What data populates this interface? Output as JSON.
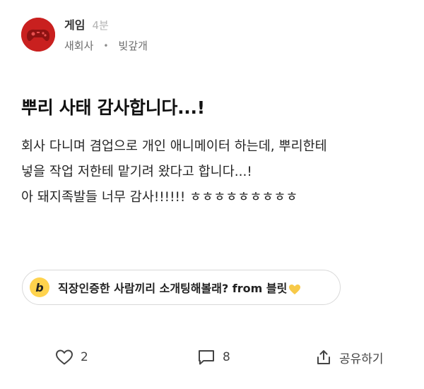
{
  "post": {
    "board_name": "게임",
    "time_ago": "4분",
    "author_company": "새회사",
    "separator": "•",
    "author_nickname": "빚갚개",
    "title": "뿌리 사태 감사합니다...!",
    "body_lines": [
      "회사 다니며 겸업으로 개인 애니메이터 하는데, 뿌리한테",
      "넣을 작업 저한테 맡기려 왔다고 합니다...!",
      "아 돼지족발들 너무 감사!!!!!! ㅎㅎㅎㅎㅎㅎㅎㅎㅎ"
    ]
  },
  "promo": {
    "badge": "b",
    "text": "직장인증한 사람끼리 소개팅해볼래? from 블릿"
  },
  "actions": {
    "like_count": "2",
    "comment_count": "8",
    "share_label": "공유하기"
  },
  "colors": {
    "avatar_bg": "#c9201f",
    "promo_badge": "#ffd34d",
    "heart_emoji": "#f7c948"
  }
}
